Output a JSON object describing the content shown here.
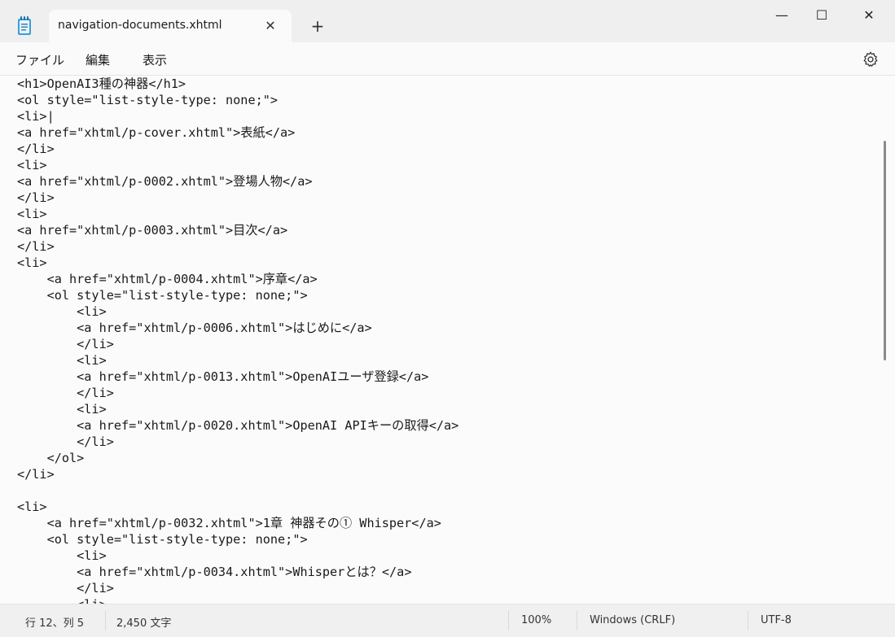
{
  "tab": {
    "title": "navigation-documents.xhtml",
    "close_icon": "close-icon",
    "new_tab_symbol": "+"
  },
  "window": {
    "minimize_symbol": "—",
    "maximize_symbol": "☐",
    "close_symbol": "✕"
  },
  "menu": {
    "file": "ファイル",
    "edit": "編集",
    "view": "表示"
  },
  "editor": {
    "lines": [
      "<h1>OpenAI3種の神器</h1>",
      "<ol style=\"list-style-type: none;\">",
      "<li>|",
      "<a href=\"xhtml/p-cover.xhtml\">表紙</a>",
      "</li>",
      "<li>",
      "<a href=\"xhtml/p-0002.xhtml\">登場人物</a>",
      "</li>",
      "<li>",
      "<a href=\"xhtml/p-0003.xhtml\">目次</a>",
      "</li>",
      "<li>",
      "    <a href=\"xhtml/p-0004.xhtml\">序章</a>",
      "    <ol style=\"list-style-type: none;\">",
      "        <li>",
      "        <a href=\"xhtml/p-0006.xhtml\">はじめに</a>",
      "        </li>",
      "        <li>",
      "        <a href=\"xhtml/p-0013.xhtml\">OpenAIユーザ登録</a>",
      "        </li>",
      "        <li>",
      "        <a href=\"xhtml/p-0020.xhtml\">OpenAI APIキーの取得</a>",
      "        </li>",
      "    </ol>",
      "</li>",
      "",
      "<li>",
      "    <a href=\"xhtml/p-0032.xhtml\">1章 神器その① Whisper</a>",
      "    <ol style=\"list-style-type: none;\">",
      "        <li>",
      "        <a href=\"xhtml/p-0034.xhtml\">Whisperとは？</a>",
      "        </li>",
      "        <li>"
    ]
  },
  "status": {
    "position": "行 12、列 5",
    "char_count": "2,450 文字",
    "zoom": "100%",
    "line_ending": "Windows (CRLF)",
    "encoding": "UTF-8"
  }
}
